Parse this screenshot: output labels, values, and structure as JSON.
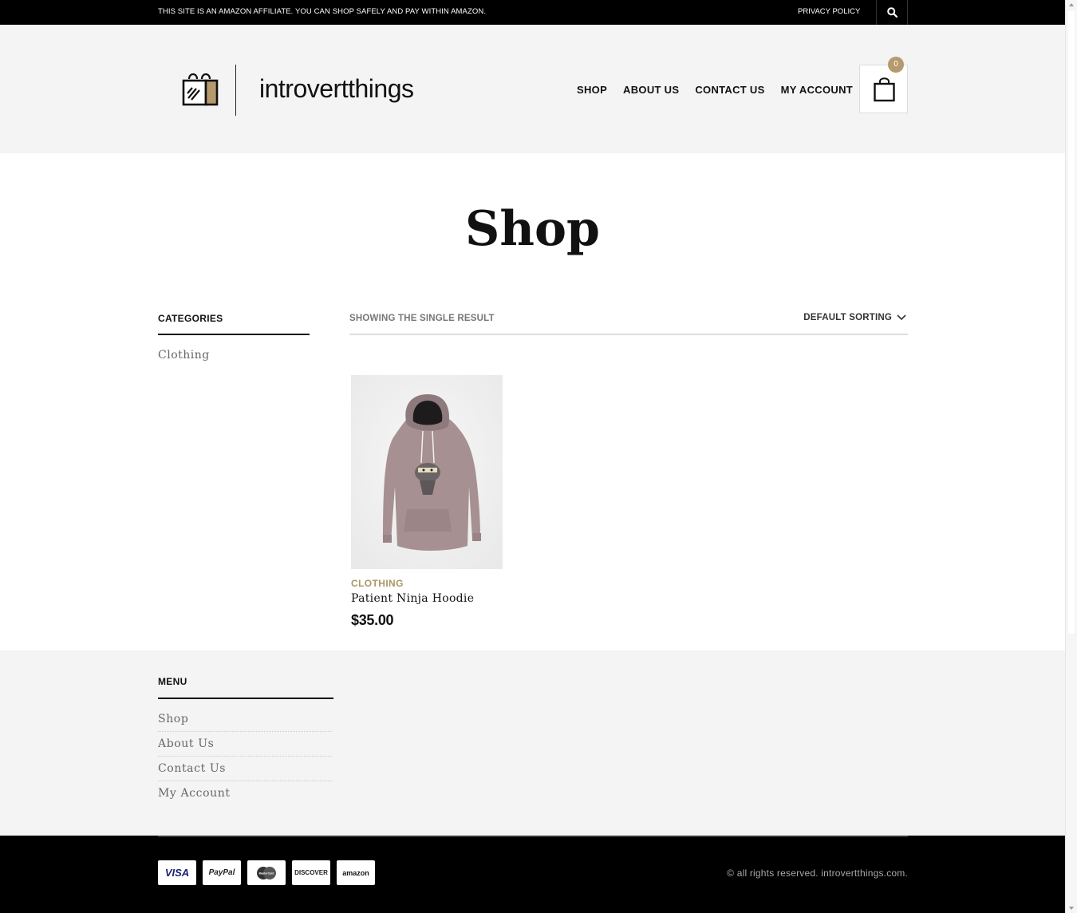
{
  "topbar": {
    "notice": "THIS SITE IS AN AMAZON AFFILIATE. YOU CAN SHOP SAFELY AND PAY WITHIN AMAZON.",
    "privacy_label": "PRIVACY POLICY"
  },
  "header": {
    "logo_text": "introvertthings",
    "nav": [
      "SHOP",
      "ABOUT US",
      "CONTACT US",
      "MY ACCOUNT"
    ],
    "cart_count": "0"
  },
  "page": {
    "title": "Shop"
  },
  "sidebar": {
    "title": "CATEGORIES",
    "categories": [
      "Clothing"
    ]
  },
  "toolbar": {
    "result_count": "SHOWING THE SINGLE RESULT",
    "sort_label": "DEFAULT SORTING"
  },
  "products": [
    {
      "category": "CLOTHING",
      "name": "Patient Ninja Hoodie",
      "price": "$35.00"
    }
  ],
  "footer": {
    "menu_title": "MENU",
    "menu_items": [
      "Shop",
      "About Us",
      "Contact Us",
      "My Account"
    ],
    "payments": [
      "VISA",
      "PayPal",
      "MasterCard",
      "DISCOVER",
      "amazon"
    ],
    "copyright": "© all rights reserved. introvertthings.com."
  },
  "colors": {
    "accent": "#b59a6e",
    "category_text": "#a99867",
    "topbar_bg": "#000000",
    "header_bg": "#f4f4f4"
  }
}
